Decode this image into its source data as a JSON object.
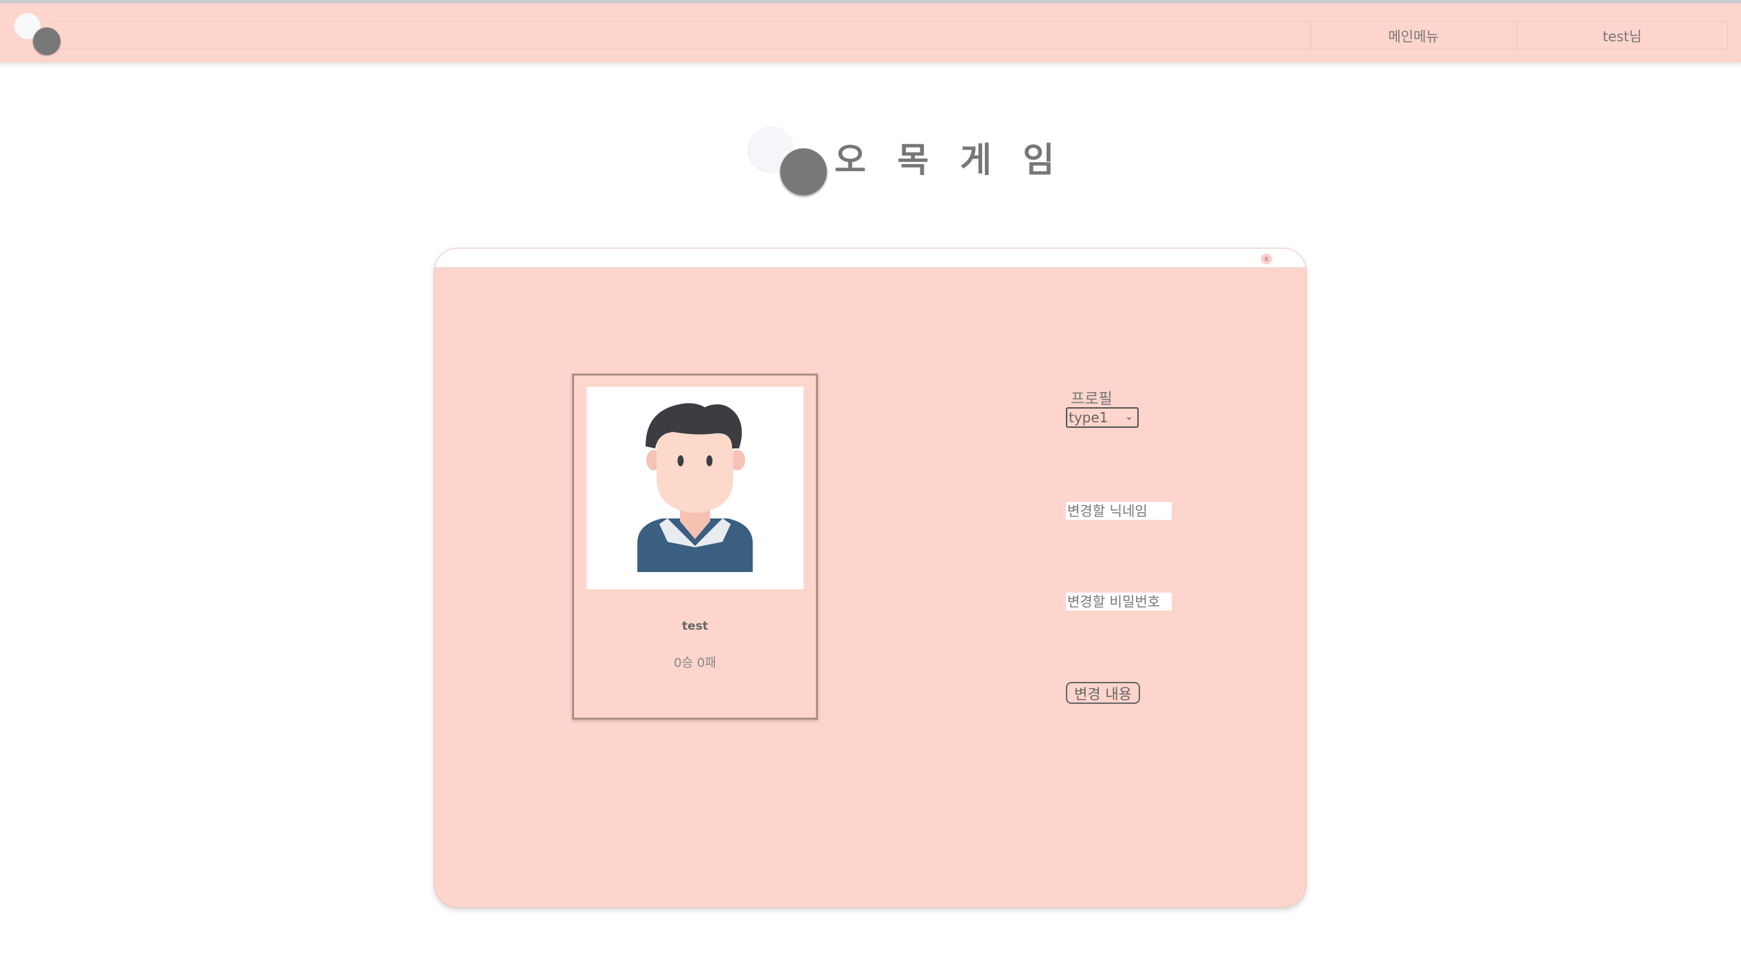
{
  "navbar": {
    "logo_icon": "omok-stones-logo-icon",
    "menu_label": "메인메뉴",
    "user_label": "test님"
  },
  "header": {
    "title": "오 목 게 임"
  },
  "modal": {
    "close_label": "x",
    "card": {
      "avatar_icon": "male-avatar-icon",
      "name": "test",
      "record": "0승 0패"
    },
    "form": {
      "profile_label": "프로필",
      "profile_select_value": "type1",
      "nickname_placeholder": "변경할 닉네임",
      "password_placeholder": "변경할 비밀번호",
      "submit_label": "변경 내용"
    }
  },
  "colors": {
    "primary_pink": "#fdd5cd",
    "text_gray": "#777777",
    "stone_black": "#787878",
    "stone_white": "#f4f6f9"
  }
}
